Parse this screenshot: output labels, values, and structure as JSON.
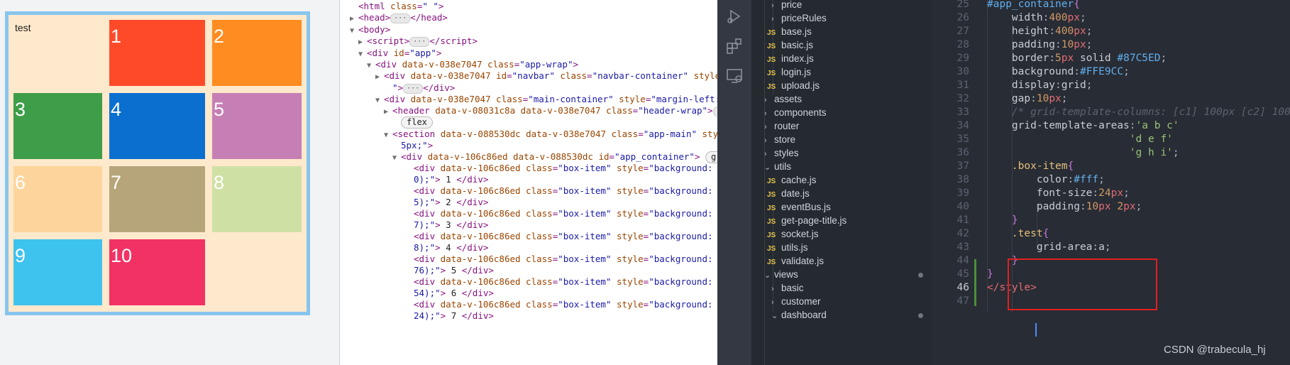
{
  "preview": {
    "cells": [
      {
        "label": "test",
        "color": "#FFE9CC"
      },
      {
        "label": "1",
        "color": "#ff4a2a"
      },
      {
        "label": "2",
        "color": "#ff8c21"
      },
      {
        "label": "3",
        "color": "#3d9d48"
      },
      {
        "label": "4",
        "color": "#0a6fcf"
      },
      {
        "label": "5",
        "color": "#c67fb5"
      },
      {
        "label": "6",
        "color": "#fdd59c"
      },
      {
        "label": "7",
        "color": "#b6a57a"
      },
      {
        "label": "8",
        "color": "#cfe0a5"
      },
      {
        "label": "9",
        "color": "#3ec2ee"
      },
      {
        "label": "10",
        "color": "#f23264"
      }
    ]
  },
  "elements": {
    "lines": [
      {
        "tri": "",
        "html": "<span class='tag'>&lt;html</span> <span class='attr'>class</span>=<span class='val'>\" \"</span><span class='tag'>&gt;</span>"
      },
      {
        "tri": "▶",
        "html": "<span class='tag'>&lt;head&gt;</span><span class='ellipsis'>···</span><span class='tag'>&lt;/head&gt;</span>"
      },
      {
        "tri": "▼",
        "html": "<span class='tag'>&lt;body&gt;</span>"
      },
      {
        "tri": "▶",
        "html": "<span class='tag'>&lt;script&gt;</span><span class='ellipsis'>···</span><span class='tag'>&lt;/script&gt;</span>"
      },
      {
        "tri": "▼",
        "html": "<span class='tag'>&lt;div</span> <span class='attr'>id</span>=<span class='val'>\"app\"</span><span class='tag'>&gt;</span>"
      },
      {
        "tri": "▼",
        "html": "<span class='tag'>&lt;div</span> <span class='attr'>data-v-038e7047 class</span>=<span class='val'>\"app-wrap\"</span><span class='tag'>&gt;</span>"
      },
      {
        "tri": "▶",
        "html": "<span class='tag'>&lt;div</span> <span class='attr'>data-v-038e7047 id</span>=<span class='val'>\"navbar\"</span> <span class='attr'>class</span>=<span class='val'>\"navbar-container\"</span> <span class='attr'>style</span>="
      },
      {
        "tri": "",
        "html": "<span class='val'>\"</span><span class='tag'>&gt;</span><span class='ellipsis'>···</span><span class='tag'>&lt;/div&gt;</span>"
      },
      {
        "tri": "▼",
        "html": "<span class='tag'>&lt;div</span> <span class='attr'>data-v-038e7047 class</span>=<span class='val'>\"main-container\"</span> <span class='attr'>style</span>=<span class='val'>\"margin-left:</span>"
      },
      {
        "tri": "▶",
        "html": "<span class='tag'>&lt;header</span> <span class='attr'>data-v-08031c8a data-v-038e7047 class</span>=<span class='val'>\"header-wrap\"</span><span class='tag'>&gt;</span><span class='ellipsis'>···</span>"
      },
      {
        "tri": "",
        "html": "<span class='badge'>flex</span>"
      },
      {
        "tri": "▼",
        "html": "<span class='tag'>&lt;section</span> <span class='attr'>data-v-088530dc data-v-038e7047 class</span>=<span class='val'>\"app-main\"</span> <span class='attr'>style</span>"
      },
      {
        "tri": "",
        "html": "<span class='val'>5px;\"</span><span class='tag'>&gt;</span>"
      },
      {
        "tri": "▼",
        "html": "<span class='tag'>&lt;div</span> <span class='attr'>data-v-106c86ed data-v-088530dc id</span>=<span class='val'>\"app_container\"</span><span class='tag'>&gt;</span> <span class='badge'>gri</span>"
      },
      {
        "tri": "",
        "html": "<span class='tag'>&lt;div</span> <span class='attr'>data-v-106c86ed class</span>=<span class='val'>\"box-item\"</span> <span class='attr'>style</span>=<span class='val'>\"background: rg</span>"
      },
      {
        "tri": "",
        "html": "<span class='val'>0);\"</span><span class='tag'>&gt;</span><span class='txt'> 1 </span><span class='tag'>&lt;/div&gt;</span>"
      },
      {
        "tri": "",
        "html": "<span class='tag'>&lt;div</span> <span class='attr'>data-v-106c86ed class</span>=<span class='val'>\"box-item\"</span> <span class='attr'>style</span>=<span class='val'>\"background: rg</span>"
      },
      {
        "tri": "",
        "html": "<span class='val'>5);\"</span><span class='tag'>&gt;</span><span class='txt'> 2 </span><span class='tag'>&lt;/div&gt;</span>"
      },
      {
        "tri": "",
        "html": "<span class='tag'>&lt;div</span> <span class='attr'>data-v-106c86ed class</span>=<span class='val'>\"box-item\"</span> <span class='attr'>style</span>=<span class='val'>\"background: rg</span>"
      },
      {
        "tri": "",
        "html": "<span class='val'>7);\"</span><span class='tag'>&gt;</span><span class='txt'> 3 </span><span class='tag'>&lt;/div&gt;</span>"
      },
      {
        "tri": "",
        "html": "<span class='tag'>&lt;div</span> <span class='attr'>data-v-106c86ed class</span>=<span class='val'>\"box-item\"</span> <span class='attr'>style</span>=<span class='val'>\"background: rg</span>"
      },
      {
        "tri": "",
        "html": "<span class='val'>8);\"</span><span class='tag'>&gt;</span><span class='txt'> 4 </span><span class='tag'>&lt;/div&gt;</span>"
      },
      {
        "tri": "",
        "html": "<span class='tag'>&lt;div</span> <span class='attr'>data-v-106c86ed class</span>=<span class='val'>\"box-item\"</span> <span class='attr'>style</span>=<span class='val'>\"background: rg</span>"
      },
      {
        "tri": "",
        "html": "<span class='val'>76);\"</span><span class='tag'>&gt;</span><span class='txt'> 5 </span><span class='tag'>&lt;/div&gt;</span>"
      },
      {
        "tri": "",
        "html": "<span class='tag'>&lt;div</span> <span class='attr'>data-v-106c86ed class</span>=<span class='val'>\"box-item\"</span> <span class='attr'>style</span>=<span class='val'>\"background: rg</span>"
      },
      {
        "tri": "",
        "html": "<span class='val'>54);\"</span><span class='tag'>&gt;</span><span class='txt'> 6 </span><span class='tag'>&lt;/div&gt;</span>"
      },
      {
        "tri": "",
        "html": "<span class='tag'>&lt;div</span> <span class='attr'>data-v-106c86ed class</span>=<span class='val'>\"box-item\"</span> <span class='attr'>style</span>=<span class='val'>\"background: rg</span>"
      },
      {
        "tri": "",
        "html": "<span class='val'>24);\"</span><span class='tag'>&gt;</span><span class='txt'> 7 </span><span class='tag'>&lt;/div&gt;</span>"
      }
    ]
  },
  "explorer": {
    "items": [
      {
        "type": "folder",
        "open": false,
        "label": "price",
        "depth": 2
      },
      {
        "type": "folder",
        "open": false,
        "label": "priceRules",
        "depth": 2
      },
      {
        "type": "js",
        "label": "base.js",
        "depth": 1
      },
      {
        "type": "js",
        "label": "basic.js",
        "depth": 1
      },
      {
        "type": "js",
        "label": "index.js",
        "depth": 1
      },
      {
        "type": "js",
        "label": "login.js",
        "depth": 1
      },
      {
        "type": "js",
        "label": "upload.js",
        "depth": 1
      },
      {
        "type": "folder",
        "open": false,
        "label": "assets",
        "depth": 1
      },
      {
        "type": "folder",
        "open": false,
        "label": "components",
        "depth": 1
      },
      {
        "type": "folder",
        "open": false,
        "label": "router",
        "depth": 1
      },
      {
        "type": "folder",
        "open": false,
        "label": "store",
        "depth": 1
      },
      {
        "type": "folder",
        "open": false,
        "label": "styles",
        "depth": 1
      },
      {
        "type": "folder",
        "open": true,
        "label": "utils",
        "depth": 1
      },
      {
        "type": "js",
        "label": "cache.js",
        "depth": 1
      },
      {
        "type": "js",
        "label": "date.js",
        "depth": 1
      },
      {
        "type": "js",
        "label": "eventBus.js",
        "depth": 1
      },
      {
        "type": "js",
        "label": "get-page-title.js",
        "depth": 1
      },
      {
        "type": "js",
        "label": "socket.js",
        "depth": 1
      },
      {
        "type": "js",
        "label": "utils.js",
        "depth": 1
      },
      {
        "type": "js",
        "label": "validate.js",
        "depth": 1
      },
      {
        "type": "folder",
        "open": true,
        "label": "views",
        "depth": 1,
        "modified": true
      },
      {
        "type": "folder",
        "open": false,
        "label": "basic",
        "depth": 2
      },
      {
        "type": "folder",
        "open": false,
        "label": "customer",
        "depth": 2
      },
      {
        "type": "folder",
        "open": true,
        "label": "dashboard",
        "depth": 2,
        "modified": true
      }
    ]
  },
  "editor": {
    "lines": [
      {
        "n": "25",
        "html": "<span class='k-sel'>#app_container</span><span class='k-brace'>{</span>"
      },
      {
        "n": "26",
        "html": "    <span class='k-prop'>width</span>:<span class='k-num'>400</span><span class='k-unit'>px</span>;"
      },
      {
        "n": "27",
        "html": "    <span class='k-prop'>height</span>:<span class='k-num'>400</span><span class='k-unit'>px</span>;"
      },
      {
        "n": "28",
        "html": "    <span class='k-prop'>padding</span>:<span class='k-num'>10</span><span class='k-unit'>px</span>;"
      },
      {
        "n": "29",
        "html": "    <span class='k-prop'>border</span>:<span class='k-num'>5</span><span class='k-unit'>px</span> <span class='k-prop'>solid</span> <span class='k-hex'>#87C5ED</span>;"
      },
      {
        "n": "30",
        "html": "    <span class='k-prop'>background</span>:<span class='k-hex'>#FFE9CC</span>;"
      },
      {
        "n": "31",
        "html": "    <span class='k-prop'>display</span>:<span class='k-prop'>grid</span>;"
      },
      {
        "n": "32",
        "html": "    <span class='k-prop'>gap</span>:<span class='k-num'>10</span><span class='k-unit'>px</span>;"
      },
      {
        "n": "33",
        "html": "    <span class='k-com'>/* grid-template-columns: [c1] 100px [c2] 100</span>"
      },
      {
        "n": "34",
        "html": "    <span class='k-prop'>grid-template-areas</span>:<span class='k-str'>'a b c'</span>"
      },
      {
        "n": "35",
        "html": "                       <span class='k-str'>'d e f'</span>"
      },
      {
        "n": "36",
        "html": "                       <span class='k-str'>'g h i'</span>;"
      },
      {
        "n": "37",
        "html": "    <span class='k-cls'>.box-item</span><span class='k-brace'>{</span>"
      },
      {
        "n": "38",
        "html": "        <span class='k-prop'>color</span>:<span class='k-hex'>#fff</span>;"
      },
      {
        "n": "39",
        "html": "        <span class='k-prop'>font-size</span>:<span class='k-num'>24</span><span class='k-unit'>px</span>;"
      },
      {
        "n": "40",
        "html": "        <span class='k-prop'>padding</span>:<span class='k-num'>10</span><span class='k-unit'>px</span> <span class='k-num'>2</span><span class='k-unit'>px</span>;"
      },
      {
        "n": "41",
        "html": "    <span class='k-brace'>}</span>"
      },
      {
        "n": "42",
        "html": "    <span class='k-cls'>.test</span><span class='k-brace'>{</span>"
      },
      {
        "n": "43",
        "html": "        <span class='k-prop'>grid-area</span>:<span class='k-prop'>a</span>;"
      },
      {
        "n": "44",
        "html": "    <span class='k-brace'>}</span>"
      },
      {
        "n": "45",
        "html": "<span class='k-brace'>}</span>"
      },
      {
        "n": "46",
        "html": "<span class='k-tag'>&lt;/style&gt;</span>"
      },
      {
        "n": "47",
        "html": ""
      }
    ],
    "current_line": "46"
  },
  "watermark": "CSDN @trabecula_hj"
}
